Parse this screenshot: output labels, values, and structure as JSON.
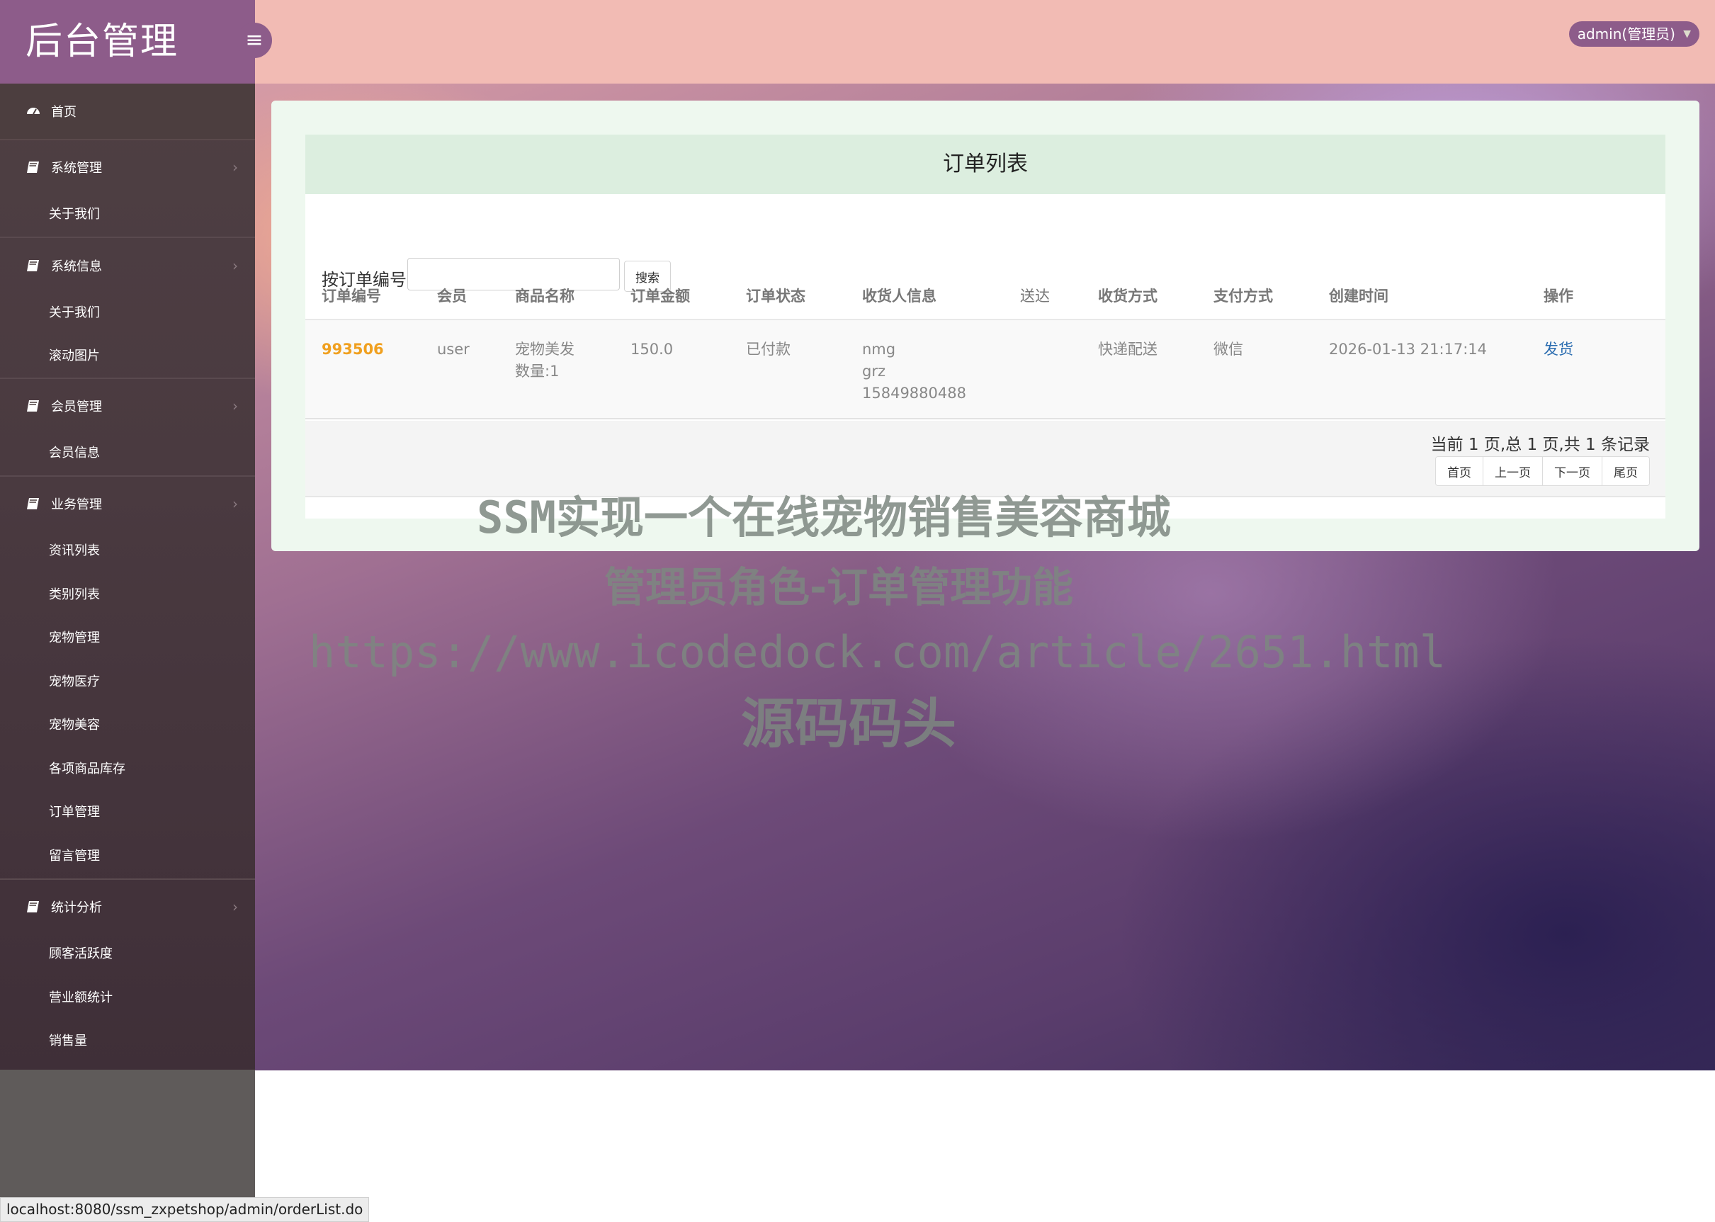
{
  "sidebar": {
    "brand": "后台管理",
    "home": "首页",
    "groups": [
      {
        "label": "系统管理",
        "items": [
          "关于我们"
        ]
      },
      {
        "label": "系统信息",
        "items": [
          "关于我们",
          "滚动图片"
        ]
      },
      {
        "label": "会员管理",
        "items": [
          "会员信息"
        ]
      },
      {
        "label": "业务管理",
        "items": [
          "资讯列表",
          "类别列表",
          "宠物管理",
          "宠物医疗",
          "宠物美容",
          "各项商品库存",
          "订单管理",
          "留言管理"
        ]
      },
      {
        "label": "统计分析",
        "items": [
          "顾客活跃度",
          "营业额统计",
          "销售量"
        ]
      }
    ]
  },
  "header": {
    "toggle_icon": "≡",
    "user_menu": "admin(管理员)"
  },
  "panel": {
    "title": "订单列表",
    "search_label": "按订单编号",
    "search_value": "",
    "search_button": "搜索"
  },
  "table": {
    "columns": [
      "订单编号",
      "会员",
      "商品名称",
      "订单金额",
      "订单状态",
      "收货人信息",
      "送达",
      "收货方式",
      "支付方式",
      "创建时间",
      "操作"
    ],
    "rows": [
      {
        "order_no": "993506",
        "member": "user",
        "product_line1": "宠物美发",
        "product_line2": "数量:1",
        "amount": "150.0",
        "status": "已付款",
        "receiver_line1": "nmg",
        "receiver_line2": "grz",
        "receiver_line3": "15849880488",
        "delivered": "",
        "shipping": "快递配送",
        "payment": "微信",
        "created": "2026-01-13 21:17:14",
        "action": "发货"
      }
    ]
  },
  "pagination": {
    "info": "当前 1 页,总 1 页,共 1 条记录",
    "buttons": [
      "首页",
      "上一页",
      "下一页",
      "尾页"
    ]
  },
  "watermark": {
    "line1": "SSM实现一个在线宠物销售美容商城",
    "line2": "管理员角色-订单管理功能",
    "line3": "https://www.icodedock.com/article/2651.html",
    "line4": "源码码头"
  },
  "status_bar": {
    "url": "localhost:8080/ssm_zxpetshop/admin/orderList.do"
  },
  "colors": {
    "brand_bg": "#8d5c8a",
    "header_bg": "#f2bbb4",
    "panel_title_bg": "#dceedf",
    "order_no": "#f0a020",
    "action_link": "#2a6cb0"
  }
}
